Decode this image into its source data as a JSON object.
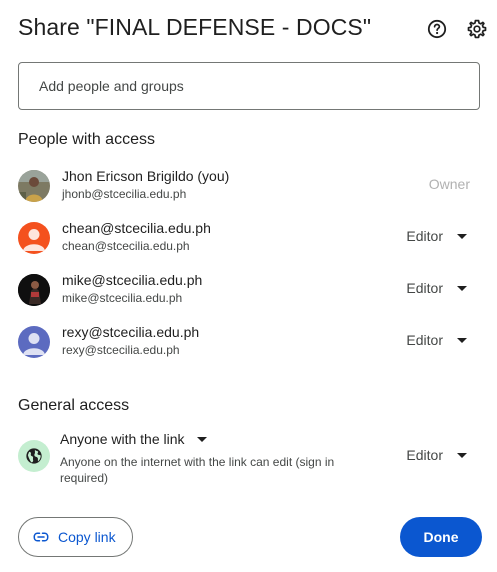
{
  "dialog": {
    "title": "Share \"FINAL DEFENSE - DOCS\"",
    "add_placeholder": "Add people and groups"
  },
  "people_section": {
    "heading": "People with access",
    "people": [
      {
        "name": "Jhon Ericson Brigildo (you)",
        "email": "jhonb@stcecilia.edu.ph",
        "role": "Owner"
      },
      {
        "name": "chean@stcecilia.edu.ph",
        "email": "chean@stcecilia.edu.ph",
        "role": "Editor"
      },
      {
        "name": "mike@stcecilia.edu.ph",
        "email": "mike@stcecilia.edu.ph",
        "role": "Editor"
      },
      {
        "name": "rexy@stcecilia.edu.ph",
        "email": "rexy@stcecilia.edu.ph",
        "role": "Editor"
      }
    ]
  },
  "general_access": {
    "heading": "General access",
    "scope": "Anyone with the link",
    "description": "Anyone on the internet with the link can edit (sign in required)",
    "role": "Editor"
  },
  "footer": {
    "copy_link_label": "Copy link",
    "done_label": "Done"
  },
  "colors": {
    "accent": "#0b57d0",
    "avatar_chean": "#f4511e",
    "avatar_rexy": "#5c6bc0",
    "globe_bg": "#c4eed0"
  },
  "icons": [
    "help-icon",
    "gear-icon",
    "globe-icon",
    "link-icon",
    "caret-down-icon"
  ]
}
